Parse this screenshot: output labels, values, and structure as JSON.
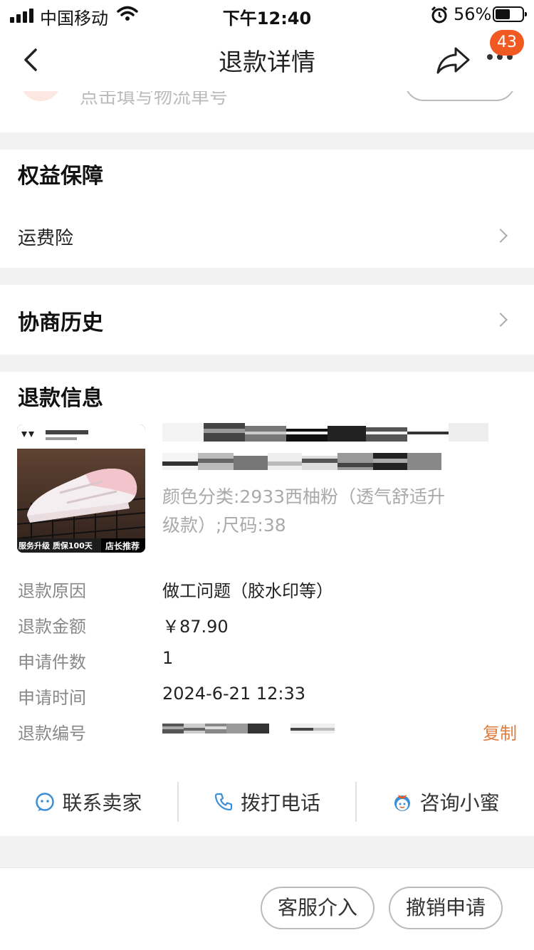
{
  "status_bar": {
    "carrier": "中国移动",
    "time": "下午12:40",
    "battery_percent": "56%",
    "battery_level": 0.56
  },
  "nav": {
    "title": "退款详情",
    "badge_count": "43"
  },
  "peek": {
    "text": "点击填写物流单号"
  },
  "rights": {
    "heading": "权益保障",
    "item": "运费险"
  },
  "history": {
    "heading": "协商历史"
  },
  "refund_info": {
    "heading": "退款信息",
    "product": {
      "spec": "颜色分类:2933西柚粉（透气舒适升级款）;尺码:38",
      "spec_line1": "颜色分类:2933西柚粉（透气舒适升",
      "spec_line2": "级款）;尺码:38",
      "image_banner_left": "服务升级 质保100天",
      "image_banner_right": "店长推荐"
    },
    "rows": [
      {
        "label": "退款原因",
        "value": "做工问题（胶水印等）"
      },
      {
        "label": "退款金额",
        "value": "￥87.90"
      },
      {
        "label": "申请件数",
        "value": "1"
      },
      {
        "label": "申请时间",
        "value": "2024-6-21 12:33"
      },
      {
        "label": "退款编号",
        "value": ""
      }
    ],
    "copy_label": "复制"
  },
  "actions": [
    {
      "label": "联系卖家",
      "icon": "chat-face-icon"
    },
    {
      "label": "拨打电话",
      "icon": "phone-icon"
    },
    {
      "label": "咨询小蜜",
      "icon": "assistant-icon"
    }
  ],
  "bottom_bar": {
    "service_label": "客服介入",
    "cancel_label": "撤销申请"
  },
  "colors": {
    "accent": "#f05a22",
    "copy": "#e07b39",
    "icon_blue": "#3a8fd6"
  }
}
